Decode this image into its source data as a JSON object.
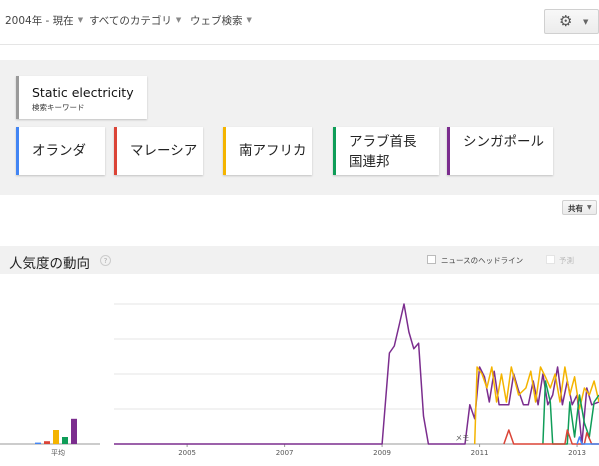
{
  "filters": [
    {
      "label": "2004年 - 現在"
    },
    {
      "label": "すべてのカテゴリ"
    },
    {
      "label": "ウェブ検索"
    }
  ],
  "settings": {
    "icon": "gear-icon"
  },
  "main_term": {
    "name": "Static electricity",
    "sublabel": "検索キーワード"
  },
  "regions": [
    {
      "label": "オランダ",
      "color": "#4285f4"
    },
    {
      "label": "マレーシア",
      "color": "#db4437"
    },
    {
      "label": "南アフリカ",
      "color": "#f4b400"
    },
    {
      "label": "アラブ首長\n国連邦",
      "color": "#0f9d58"
    },
    {
      "label": "シンガポール",
      "color": "#7b2d8e"
    }
  ],
  "share": {
    "label": "共有"
  },
  "interest": {
    "title": "人気度の動向",
    "help": "?",
    "news_label": "ニュースのヘッドライン",
    "forecast_label": "予測",
    "note_label": "メモ"
  },
  "chart_data": {
    "type": "line",
    "average_label": "平均",
    "averages": [
      {
        "series": "オランダ",
        "value": 1
      },
      {
        "series": "マレーシア",
        "value": 2
      },
      {
        "series": "南アフリカ",
        "value": 10
      },
      {
        "series": "アラブ首長国連邦",
        "value": 5
      },
      {
        "series": "シンガポール",
        "value": 18
      }
    ],
    "x_ticks": [
      "2005",
      "2007",
      "2009",
      "2011",
      "2013"
    ],
    "xlim": [
      2004,
      2013.95
    ],
    "ylim": [
      0,
      100
    ],
    "grid": true,
    "series": [
      {
        "name": "シンガポール",
        "color": "#7b2d8e",
        "points": [
          [
            2004,
            0
          ],
          [
            2009.5,
            0
          ],
          [
            2009.65,
            65
          ],
          [
            2009.75,
            70
          ],
          [
            2009.85,
            85
          ],
          [
            2009.95,
            100
          ],
          [
            2010.05,
            80
          ],
          [
            2010.15,
            68
          ],
          [
            2010.25,
            72
          ],
          [
            2010.35,
            20
          ],
          [
            2010.45,
            0
          ],
          [
            2011.2,
            0
          ],
          [
            2011.3,
            28
          ],
          [
            2011.4,
            18
          ],
          [
            2011.5,
            55
          ],
          [
            2011.6,
            48
          ],
          [
            2011.7,
            30
          ],
          [
            2011.8,
            52
          ],
          [
            2011.9,
            28
          ],
          [
            2012.0,
            28
          ],
          [
            2012.1,
            28
          ],
          [
            2012.2,
            50
          ],
          [
            2012.3,
            38
          ],
          [
            2012.4,
            28
          ],
          [
            2012.5,
            28
          ],
          [
            2012.6,
            45
          ],
          [
            2012.7,
            28
          ],
          [
            2012.8,
            50
          ],
          [
            2012.9,
            28
          ],
          [
            2013.0,
            35
          ],
          [
            2013.1,
            55
          ],
          [
            2013.2,
            28
          ],
          [
            2013.3,
            45
          ],
          [
            2013.4,
            28
          ],
          [
            2013.5,
            35
          ],
          [
            2013.6,
            0
          ],
          [
            2013.7,
            40
          ],
          [
            2013.8,
            28
          ],
          [
            2013.95,
            30
          ]
        ]
      },
      {
        "name": "南アフリカ",
        "color": "#f4b400",
        "points": [
          [
            2011.4,
            0
          ],
          [
            2011.45,
            55
          ],
          [
            2011.55,
            50
          ],
          [
            2011.65,
            40
          ],
          [
            2011.75,
            55
          ],
          [
            2011.85,
            30
          ],
          [
            2011.95,
            50
          ],
          [
            2012.05,
            30
          ],
          [
            2012.15,
            55
          ],
          [
            2012.3,
            35
          ],
          [
            2012.45,
            40
          ],
          [
            2012.55,
            52
          ],
          [
            2012.65,
            30
          ],
          [
            2012.75,
            55
          ],
          [
            2012.85,
            48
          ],
          [
            2012.95,
            40
          ],
          [
            2013.05,
            50
          ],
          [
            2013.15,
            30
          ],
          [
            2013.25,
            55
          ],
          [
            2013.35,
            35
          ],
          [
            2013.45,
            48
          ],
          [
            2013.55,
            25
          ],
          [
            2013.65,
            40
          ],
          [
            2013.75,
            35
          ],
          [
            2013.85,
            45
          ],
          [
            2013.95,
            30
          ]
        ]
      },
      {
        "name": "アラブ首長国連邦",
        "color": "#0f9d58",
        "points": [
          [
            2012.8,
            0
          ],
          [
            2012.85,
            45
          ],
          [
            2012.95,
            30
          ],
          [
            2013.0,
            0
          ],
          [
            2013.3,
            0
          ],
          [
            2013.35,
            30
          ],
          [
            2013.45,
            5
          ],
          [
            2013.55,
            35
          ],
          [
            2013.65,
            15
          ],
          [
            2013.75,
            5
          ],
          [
            2013.85,
            30
          ],
          [
            2013.95,
            35
          ]
        ]
      },
      {
        "name": "マレーシア",
        "color": "#db4437",
        "points": [
          [
            2012.0,
            0
          ],
          [
            2012.1,
            10
          ],
          [
            2012.2,
            0
          ],
          [
            2013.25,
            0
          ],
          [
            2013.3,
            10
          ],
          [
            2013.4,
            0
          ],
          [
            2013.65,
            0
          ],
          [
            2013.7,
            8
          ],
          [
            2013.8,
            0
          ],
          [
            2013.95,
            0
          ]
        ]
      },
      {
        "name": "オランダ",
        "color": "#4285f4",
        "points": [
          [
            2013.5,
            0
          ],
          [
            2013.55,
            5
          ],
          [
            2013.6,
            0
          ],
          [
            2013.95,
            0
          ]
        ]
      }
    ]
  }
}
